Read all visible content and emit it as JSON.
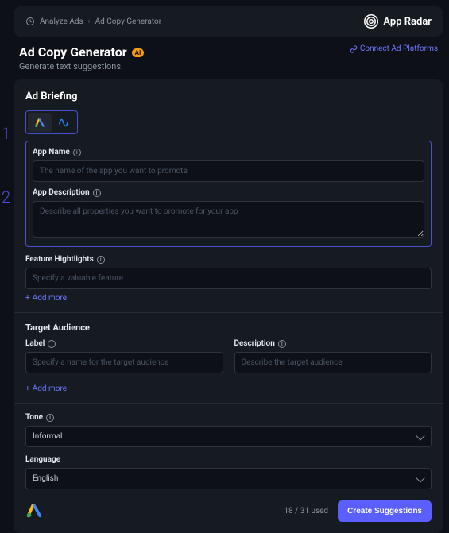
{
  "side_markers": [
    "1",
    "2"
  ],
  "breadcrumb": {
    "item1": "Analyze Ads",
    "item2": "Ad Copy Generator"
  },
  "brand": "App Radar",
  "page": {
    "title": "Ad Copy Generator",
    "ai_badge": "AI",
    "subtitle": "Generate text suggestions.",
    "connect": "Connect Ad Platforms"
  },
  "briefing": {
    "heading": "Ad Briefing",
    "app_name": {
      "label": "App Name",
      "placeholder": "The name of the app you want to promote"
    },
    "app_desc": {
      "label": "App Description",
      "placeholder": "Describe all properties you want to promote for your app"
    },
    "features": {
      "label": "Feature Hightlights",
      "placeholder": "Specify a valuable feature",
      "add_more": "Add more"
    },
    "audience": {
      "heading": "Target Audience",
      "label": {
        "label": "Label",
        "placeholder": "Specify a name for the target audience"
      },
      "desc": {
        "label": "Description",
        "placeholder": "Describe the target audience"
      },
      "add_more": "Add more"
    },
    "tone": {
      "label": "Tone",
      "value": "Informal"
    },
    "language": {
      "label": "Language",
      "value": "English"
    }
  },
  "footer": {
    "usage": "18 / 31 used",
    "cta": "Create Suggestions"
  }
}
